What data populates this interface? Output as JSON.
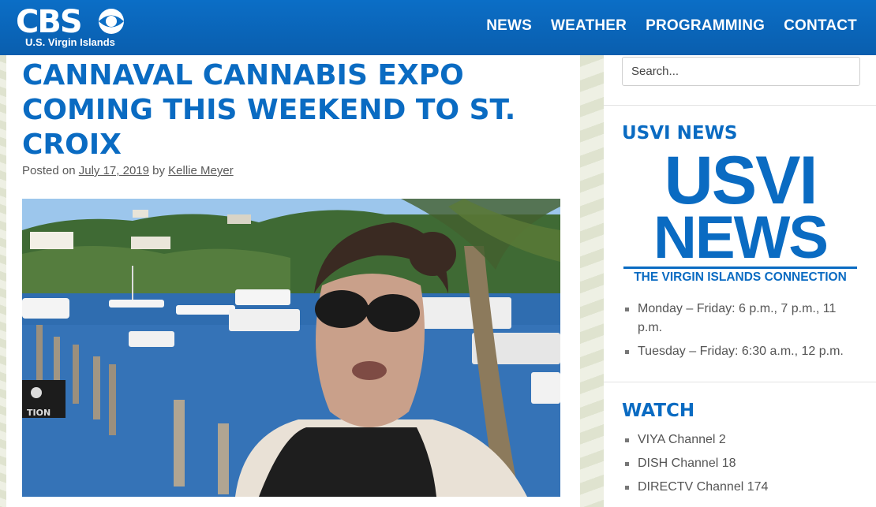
{
  "header": {
    "logo_text": "CBS",
    "logo_subtitle": "U.S. Virgin Islands",
    "nav": [
      "NEWS",
      "WEATHER",
      "PROGRAMMING",
      "CONTACT"
    ]
  },
  "article": {
    "title": "CANNAVAL CANNABIS EXPO COMING THIS WEEKEND TO ST. CROIX",
    "posted_prefix": "Posted on",
    "date": "July 17, 2019",
    "by": "by",
    "author": "Kellie Meyer",
    "photo_sign_text": "TION"
  },
  "sidebar": {
    "search_placeholder": "Search...",
    "usvi_news": {
      "title": "USVI NEWS",
      "logo_line1": "USVI",
      "logo_line2": "NEWS",
      "logo_tagline": "THE VIRGIN ISLANDS CONNECTION",
      "schedule": [
        "Monday – Friday: 6 p.m., 7 p.m., 11 p.m.",
        "Tuesday – Friday: 6:30 a.m., 12 p.m."
      ]
    },
    "watch": {
      "title": "WATCH",
      "channels": [
        "VIYA Channel 2",
        "DISH Channel 18",
        "DIRECTV Channel 174"
      ]
    }
  },
  "colors": {
    "brand_blue": "#0a6bc2",
    "header_blue": "#0b6ec6",
    "meta_gray": "#5a5a5a"
  }
}
